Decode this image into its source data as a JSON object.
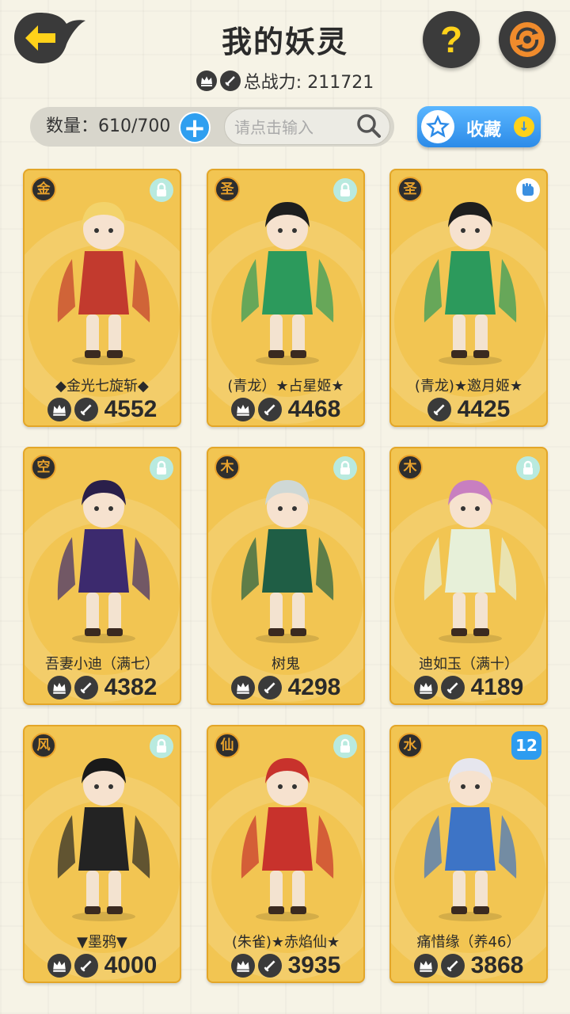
{
  "header": {
    "title": "我的妖灵",
    "total_power_label": "总战力: 211721"
  },
  "toolbar": {
    "count_label": "数量：610/700",
    "add_label": "+",
    "search_placeholder": "请点击输入",
    "collect_label": "收藏"
  },
  "cards": [
    {
      "element": "金",
      "name": "◆金光七旋斩◆",
      "power": "4552",
      "badge": "lock",
      "accent": "#c23a2e",
      "hair": "#f3d36b",
      "show_crown": true
    },
    {
      "element": "圣",
      "name": "(青龙）★占星姬★",
      "power": "4468",
      "badge": "lock",
      "accent": "#2c9a5c",
      "hair": "#1e1e1e",
      "show_crown": true
    },
    {
      "element": "圣",
      "name": "(青龙)★邀月姬★",
      "power": "4425",
      "badge": "fist",
      "accent": "#2c9a5c",
      "hair": "#1e1e1e",
      "show_crown": false
    },
    {
      "element": "空",
      "name": "吾妻小迪（满七）",
      "power": "4382",
      "badge": "lock",
      "accent": "#3c2a6e",
      "hair": "#2a1f4a",
      "show_crown": true
    },
    {
      "element": "木",
      "name": "树鬼",
      "power": "4298",
      "badge": "lock",
      "accent": "#1f5e45",
      "hair": "#cfd8d6",
      "show_crown": true
    },
    {
      "element": "木",
      "name": "迪如玉（满十）",
      "power": "4189",
      "badge": "lock",
      "accent": "#e7f0d9",
      "hair": "#c87fc0",
      "show_crown": true
    },
    {
      "element": "风",
      "name": "▼墨鸦▼",
      "power": "4000",
      "badge": "lock",
      "accent": "#232323",
      "hair": "#1a1a1a",
      "show_crown": true
    },
    {
      "element": "仙",
      "name": "(朱雀)★赤焰仙★",
      "power": "3935",
      "badge": "lock",
      "accent": "#c8322c",
      "hair": "#c8322c",
      "show_crown": true
    },
    {
      "element": "水",
      "name": "痛惜缘（养46）",
      "power": "3868",
      "badge": "level",
      "level": "12",
      "accent": "#3d74c6",
      "hair": "#e6e6ee",
      "show_crown": true
    }
  ]
}
